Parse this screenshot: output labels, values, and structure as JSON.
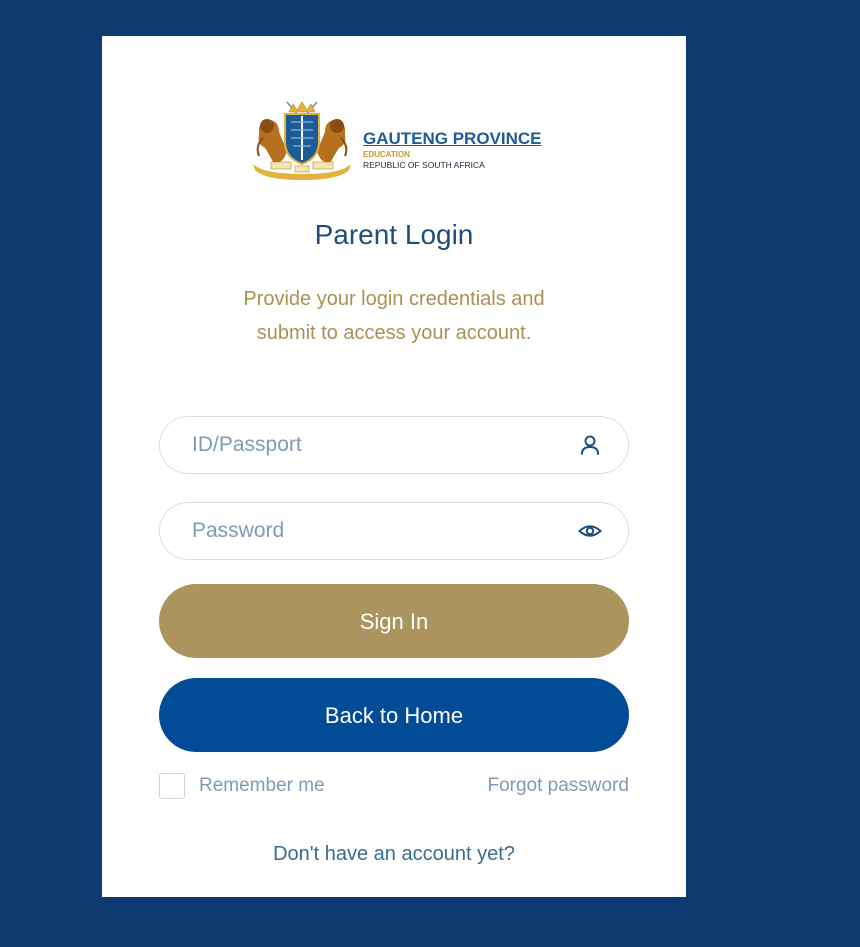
{
  "logo": {
    "province": "GAUTENG PROVINCE",
    "department": "EDUCATION",
    "country": "REPUBLIC OF SOUTH AFRICA",
    "motto_left": "UNITY",
    "motto_center": "IN",
    "motto_right": "DIVERSITY"
  },
  "heading": {
    "title": "Parent Login",
    "subtitle_line1": "Provide your login credentials and",
    "subtitle_line2": "submit to access your account."
  },
  "form": {
    "id_placeholder": "ID/Passport",
    "id_icon": "user-icon",
    "password_placeholder": "Password",
    "password_icon": "eye-icon",
    "signin_label": "Sign In",
    "home_label": "Back to Home",
    "remember_label": "Remember me",
    "remember_checked": false,
    "forgot_label": "Forgot password",
    "signup_label": "Don't have an account yet?"
  },
  "colors": {
    "page_background": "#0e3a72",
    "card": "#ffffff",
    "title": "#1f4e7a",
    "subtitle": "#ab9055",
    "signin_button": "#ab945d",
    "home_button": "#014b97",
    "muted_text": "#7f9bb4"
  }
}
